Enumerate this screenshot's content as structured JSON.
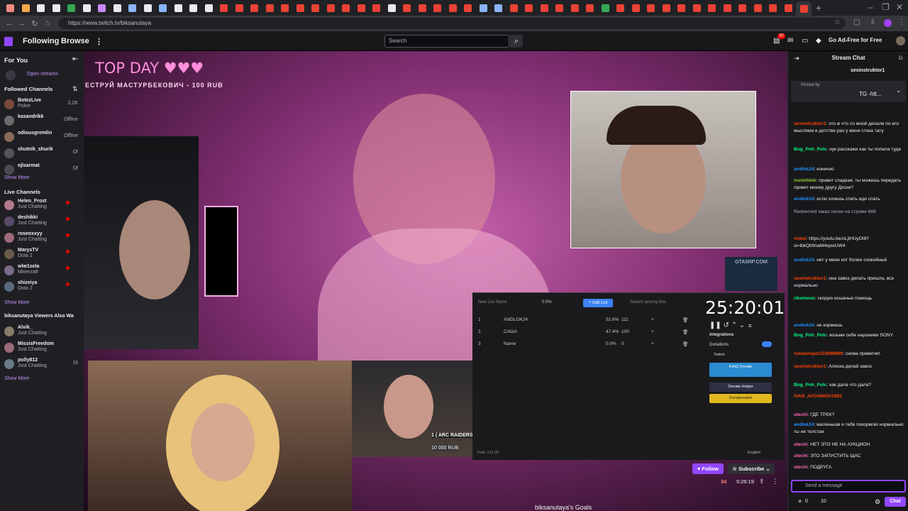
{
  "browser": {
    "url": "https://www.twitch.tv/biksanutaya",
    "tab_colors": [
      "#f28b82",
      "#f6a84b",
      "#e8eaed",
      "#e8eaed",
      "#34a853",
      "#e8eaed",
      "#c58af9",
      "#e8eaed",
      "#8ab4f8",
      "#e8eaed",
      "#8ab4f8",
      "#e8eaed",
      "#e8eaed",
      "#e8eaed",
      "#e94235",
      "#e94235",
      "#e94235",
      "#e94235",
      "#e94235",
      "#e94235",
      "#e94235",
      "#e94235",
      "#e94235",
      "#e94235",
      "#e94235",
      "#e8eaed",
      "#e94235",
      "#e94235",
      "#e94235",
      "#e94235",
      "#e94235",
      "#8ab4f8",
      "#8ab4f8",
      "#e94235",
      "#e94235",
      "#e94235",
      "#e94235",
      "#e94235",
      "#e94235",
      "#34a853",
      "#e94235",
      "#e94235",
      "#e94235",
      "#e94235",
      "#e94235",
      "#e94235",
      "#e94235",
      "#e94235",
      "#e94235",
      "#e94235",
      "#e94235",
      "#e94235",
      "#e94235"
    ],
    "new_tab_label": "+"
  },
  "nav": {
    "following": "Following",
    "browse": "Browse",
    "search_placeholder": "Search",
    "notif_count": "30",
    "ad_free": "Go Ad-Free for Free"
  },
  "sidebar": {
    "for_you": "For You",
    "open_streams": "Open streams",
    "followed_title": "Followed Channels",
    "followed": [
      {
        "name": "BotezLive",
        "sub": "Poker",
        "status": "2.2K",
        "color": "#7a4a3a"
      },
      {
        "name": "kasandrikk",
        "sub": "",
        "status": "Offline",
        "color": "#6b6b6b"
      },
      {
        "name": "odiousgremlin",
        "sub": "",
        "status": "Offline",
        "color": "#8a6a5a"
      },
      {
        "name": "shutnik_shurik",
        "sub": "",
        "status": "Of",
        "color": "#55555a"
      },
      {
        "name": "ejlsarmat",
        "sub": "",
        "status": "Of",
        "color": "#4a4a52"
      }
    ],
    "show_more_1": "Show More",
    "live_title": "Live Channels",
    "live": [
      {
        "name": "Helen_Frost",
        "sub": "Just Chatting",
        "color": "#b07a8a"
      },
      {
        "name": "deshikki",
        "sub": "Just Chatting",
        "color": "#5a4a6a"
      },
      {
        "name": "roseoxxyy",
        "sub": "Just Chatting",
        "color": "#a06a7a"
      },
      {
        "name": "MarysTV",
        "sub": "Dota 2",
        "color": "#6a5a4a"
      },
      {
        "name": "wlw1sela",
        "sub": "Minecraft",
        "color": "#7a6a8a"
      },
      {
        "name": "shizeiya",
        "sub": "Dota 2",
        "color": "#5a6a7a"
      }
    ],
    "show_more_2": "Show More",
    "also_title": "biksanutaya Viewers Also Wa",
    "also": [
      {
        "name": "Alvik_",
        "sub": "Just Chatting",
        "status": "",
        "color": "#8a7a6a"
      },
      {
        "name": "MissisFreedom",
        "sub": "Just Chatting",
        "status": "",
        "color": "#9a6a7a"
      },
      {
        "name": "polly812",
        "sub": "Just Chatting",
        "status": "16",
        "color": "#6a7a8a"
      }
    ],
    "show_more_3": "Show More"
  },
  "video": {
    "top_day": "TOP DAY ♥♥♥",
    "ticker": "ЕСТРУЙ МАСТУРБЕКОВИЧ - 100 RUB",
    "arc_label": "1 ( ARC RAIDERS",
    "arc_amount": "10 000 RUB",
    "gtasrp": "GTASRP.COM"
  },
  "panel": {
    "new_list": "New List Name",
    "pct": "0.0%",
    "add_list": "+ Add List",
    "search": "Search among lists",
    "rows": [
      {
        "num": "1",
        "name": "ANDLOK24",
        "pct": "52.6%",
        "val": "111"
      },
      {
        "num": "2",
        "name": "САША",
        "pct": "47.4%",
        "val": "100"
      },
      {
        "num": "3",
        "name": "Name",
        "pct": "0.0%",
        "val": "0"
      }
    ],
    "timer": "25:20:01",
    "integrations": "Integrations",
    "donations": "Donations",
    "twitch": "Twitch",
    "btn_donate": "IHAQ Donate",
    "btn_helper": "Donate Helper",
    "btn_alert": "Donationalert",
    "english": "English",
    "total": "Total: 211,00"
  },
  "bottom": {
    "follow": "♥ Follow",
    "subscribe": "☆ Subscribe ⌄",
    "viewers": "34",
    "uptime": "5:26:19",
    "goals": "biksanutaya's Goals"
  },
  "chat": {
    "title": "Stream Chat",
    "top_user": "sexinstruktor1",
    "pinned": "Pinned by",
    "pinned_text": "TG -htt...",
    "messages": [
      {
        "user": "sexinstruktor1",
        "color": "#ff4500",
        "text": "это ж что со мной делали по его мыслями в детстве раз у меня стока тату"
      },
      {
        "user": "Bog_Poh_Polc",
        "color": "#00ff7f",
        "text": "нук расскажи как ты попала туда"
      },
      {
        "user": "andlok24",
        "color": "#1e90ff",
        "text": "конечно"
      },
      {
        "user": "nuninhleb",
        "color": "#9acd32",
        "text": "привет сладкая, ты можешь передать привет моему другу Диззи?"
      },
      {
        "user": "andlok24",
        "color": "#1e90ff",
        "text": "если хочешь спать иди спать"
      },
      {
        "user": "",
        "color": "#adadb8",
        "text": "Redeemed заказ песни на стриме  666"
      },
      {
        "user": "rinkei",
        "color": "#ff4500",
        "text": "https://youtu.be/oLjtHUyOI8?si=lbkQb9naM4xpwUW4"
      },
      {
        "user": "andlok24",
        "color": "#1e90ff",
        "text": "нет у меня кот более спокойный"
      },
      {
        "user": "sexinstruktor1",
        "color": "#ff4500",
        "text": "она завоз делать пришла, все нормально"
      },
      {
        "user": "rikomenn",
        "color": "#00ff7f",
        "text": "скорую кошачью помощь"
      },
      {
        "user": "andlok24",
        "color": "#1e90ff",
        "text": "не кормишь"
      },
      {
        "user": "Bog_Poh_Polc",
        "color": "#00ff7f",
        "text": "возьми себе наушники SONY."
      },
      {
        "user": "ruslanreper222666999",
        "color": "#ff4500",
        "text": "снова приветик\\"
      },
      {
        "user": "sexinstruktor1",
        "color": "#ff4500",
        "text": "Аляска делай завоз"
      },
      {
        "user": "Bog_Poh_Polc",
        "color": "#00ff7f",
        "text": "как дала что дала?"
      },
      {
        "user": "IVAN_AVCHINOV1993",
        "color": "#ff4500",
        "text": ""
      },
      {
        "user": "utechi",
        "color": "#ff69b4",
        "text": "ГДЕ ТРЕК?"
      },
      {
        "user": "andlok24",
        "color": "#1e90ff",
        "text": "маленькая я тебя покормлю нормально ты не толстая"
      },
      {
        "user": "utechi",
        "color": "#ff69b4",
        "text": "НЕТ ЭТО НЕ НА АУКЦИОН"
      },
      {
        "user": "utechi",
        "color": "#ff69b4",
        "text": "ЭТО ЗАПУСТИТЬ ЩАС"
      },
      {
        "user": "utechi",
        "color": "#ff69b4",
        "text": "ПОДРУГА"
      }
    ],
    "input_placeholder": "Send a message",
    "points": "0",
    "points2": "10",
    "chat_btn": "Chat"
  }
}
